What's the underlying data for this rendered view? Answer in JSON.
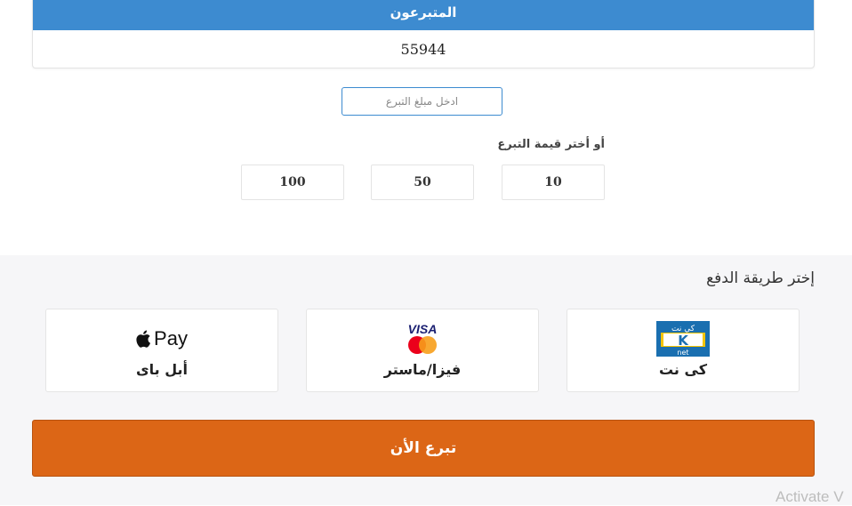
{
  "donors": {
    "title": "المتبرعون",
    "count": "55944"
  },
  "amount_input": {
    "placeholder": "ادخل مبلغ التبرع",
    "value": ""
  },
  "choose_amount": {
    "label": "أو أختر قيمة التبرع",
    "options": [
      "10",
      "50",
      "100"
    ]
  },
  "payment": {
    "title": "إختر طريقة الدفع",
    "methods": [
      {
        "label": "كى نت",
        "icon": "knet-logo"
      },
      {
        "label": "فيزا/ماستر",
        "icon": "visa-mastercard-logo",
        "brand_text": "VISA"
      },
      {
        "label": "أبل باى",
        "icon": "apple-pay-logo",
        "brand_text": "Pay"
      }
    ]
  },
  "donate_button": {
    "label": "تبرع الأن"
  },
  "system": {
    "activate_text": "Activate V"
  },
  "colors": {
    "primary_blue": "#3d8bd0",
    "donate_orange": "#dc6616",
    "knet_blue": "#1a6fb0",
    "mastercard_red": "#eb001b",
    "mastercard_yellow": "#f79e1b",
    "visa_blue": "#1a1f71"
  }
}
